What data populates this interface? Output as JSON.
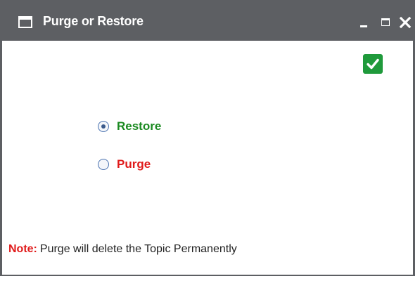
{
  "window": {
    "title": "Purge or Restore",
    "controls": [
      "minimize",
      "maximize",
      "close"
    ]
  },
  "options": [
    {
      "label": "Restore",
      "selected": true,
      "color": "#1b8a21"
    },
    {
      "label": "Purge",
      "selected": false,
      "color": "#e01a1a"
    }
  ],
  "confirm": {
    "icon": "checkmark-icon",
    "color": "#1f9a3b"
  },
  "note": {
    "label": "Note:",
    "text": "Purge will delete the Topic Permanently"
  },
  "colors": {
    "titlebar": "#5d5f63",
    "note_label": "#e01a1a"
  }
}
